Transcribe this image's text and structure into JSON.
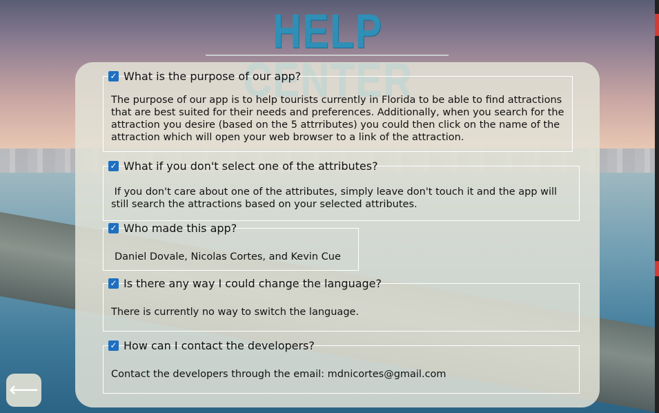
{
  "header": {
    "title": "HELP CENTER"
  },
  "faq": [
    {
      "question": "What is the purpose of our app?",
      "answer": "The purpose of our app is to help tourists currently in Florida to be able to find attractions that are best suited for their needs and preferences. Additionally, when you search for the attraction you desire (based on the 5 attrributes) you could then click on the name of the attraction which will open your web browser to a link of the attraction.",
      "checked": true
    },
    {
      "question": "What if you don't select one of the attributes?",
      "answer": " If you don't care about one of the attributes, simply leave don't touch it and the app will still search the attractions based on your selected attributes.",
      "checked": true
    },
    {
      "question": "Who made this app?",
      "answer": "Daniel Dovale, Nicolas Cortes, and Kevin Cue",
      "checked": true
    },
    {
      "question": "Is there any way I could change the language?",
      "answer": "There is currently no way to switch the language.",
      "checked": true
    },
    {
      "question": "How can I contact the developers?",
      "answer": "Contact the developers through the email: mdnicortes@gmail.com",
      "checked": true
    }
  ],
  "navigation": {
    "back_icon": "left-arrow-icon",
    "back_glyph": "⟵"
  },
  "colors": {
    "title": "#2f8fb6",
    "checkbox": "#1e6fc0",
    "panel": "#e2e2d6"
  }
}
